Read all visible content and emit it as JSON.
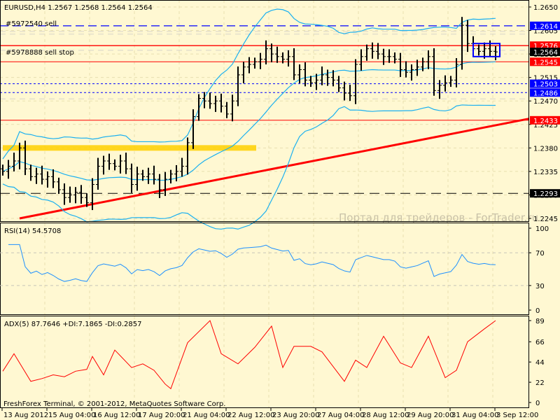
{
  "header": {
    "symbol_line": "EURUSD,H4  1.2567 1.2568 1.2564 1.2564"
  },
  "orders": [
    {
      "label": "#5972540 sell",
      "price": 1.2614,
      "color": "#0000ff",
      "style": "dash"
    },
    {
      "label": "#5978888 sell stop",
      "price": 1.2576,
      "color": "#ff0000",
      "style": "solid"
    }
  ],
  "price_labels": [
    {
      "text": "1.2614",
      "price": 1.2614,
      "bg": "#0000ff"
    },
    {
      "text": "1.2576",
      "price": 1.2576,
      "bg": "#ff0000"
    },
    {
      "text": "1.2564",
      "price": 1.2564,
      "bg": "#000000"
    },
    {
      "text": "1.2545",
      "price": 1.2545,
      "bg": "#ff0000"
    },
    {
      "text": "1.2503",
      "price": 1.2503,
      "bg": "#0000ff"
    },
    {
      "text": "1.2486",
      "price": 1.2486,
      "bg": "#0000ff"
    },
    {
      "text": "1.2433",
      "price": 1.2433,
      "bg": "#ff0000"
    },
    {
      "text": "1.2293",
      "price": 1.2293,
      "bg": "#000000"
    }
  ],
  "hlines": [
    {
      "price": 1.2545,
      "color": "#ff0000",
      "style": "solid"
    },
    {
      "price": 1.2503,
      "color": "#0000ff",
      "style": "dot"
    },
    {
      "price": 1.2486,
      "color": "#0000ff",
      "style": "dot"
    },
    {
      "price": 1.2433,
      "color": "#ff0000",
      "style": "solid"
    },
    {
      "price": 1.2293,
      "color": "#000000",
      "style": "longdash"
    }
  ],
  "watermark": "Портал для трейдеров - ForTrader.ru",
  "footer": "FreshForex Terminal, © 2001-2012, MetaQuotes Software Corp.",
  "chart_data": [
    {
      "type": "ohlc",
      "title": "EURUSD,H4",
      "ylim": [
        1.2245,
        1.265
      ],
      "y_ticks": [
        "1.2650",
        "1.2605",
        "1.2560",
        "1.2515",
        "1.2470",
        "1.2425",
        "1.2380",
        "1.2335",
        "1.2290",
        "1.2245"
      ],
      "x_ticks": [
        "13 Aug 2012",
        "15 Aug 04:00",
        "16 Aug 12:00",
        "17 Aug 20:00",
        "21 Aug 04:00",
        "22 Aug 12:00",
        "23 Aug 20:00",
        "27 Aug 04:00",
        "28 Aug 12:00",
        "29 Aug 20:00",
        "31 Aug 04:00",
        "3 Sep 12:00"
      ],
      "close": [
        1.2335,
        1.2345,
        1.2355,
        1.238,
        1.234,
        1.2325,
        1.233,
        1.232,
        1.2325,
        1.2315,
        1.23,
        1.2285,
        1.229,
        1.2295,
        1.2285,
        1.2275,
        1.231,
        1.2345,
        1.2355,
        1.235,
        1.2345,
        1.2355,
        1.234,
        1.231,
        1.233,
        1.2325,
        1.233,
        1.232,
        1.23,
        1.232,
        1.233,
        1.2335,
        1.2345,
        1.239,
        1.244,
        1.2475,
        1.247,
        1.2465,
        1.247,
        1.246,
        1.2445,
        1.247,
        1.252,
        1.2535,
        1.254,
        1.2545,
        1.255,
        1.257,
        1.256,
        1.2555,
        1.255,
        1.2555,
        1.252,
        1.253,
        1.251,
        1.2505,
        1.251,
        1.252,
        1.2515,
        1.251,
        1.2495,
        1.2485,
        1.248,
        1.254,
        1.2555,
        1.257,
        1.2565,
        1.256,
        1.2555,
        1.2555,
        1.255,
        1.253,
        1.2525,
        1.253,
        1.2535,
        1.2545,
        1.2555,
        1.249,
        1.25,
        1.2505,
        1.251,
        1.254,
        1.2615,
        1.258,
        1.257,
        1.2565,
        1.257,
        1.2565,
        1.2564
      ],
      "trendline": {
        "from": [
          3,
          1.2245
        ],
        "to": [
          94,
          1.2436
        ],
        "color": "#ff0000"
      },
      "zone": {
        "price": 1.238,
        "from_bar": 0,
        "to_bar": 45,
        "color": "#ffd000"
      },
      "band_color": "#1ab0f0"
    },
    {
      "type": "line",
      "title": "RSI(14) 54.5708",
      "ylim": [
        0,
        100
      ],
      "y_ticks": [
        "100",
        "70",
        "30",
        "0"
      ],
      "levels": [
        70,
        30
      ],
      "color": "#1e90ff"
    },
    {
      "type": "line",
      "title": "ADX(5) 87.7646 +DI:7.1865 -DI:0.2857",
      "ylim": [
        0,
        89
      ],
      "y_ticks": [
        "89",
        "66",
        "44",
        "22",
        "0"
      ],
      "color": "#ff0000",
      "adx": [
        [
          0,
          34
        ],
        [
          2,
          53
        ],
        [
          5,
          23
        ],
        [
          7,
          26
        ],
        [
          9,
          30
        ],
        [
          11,
          28
        ],
        [
          13,
          34
        ],
        [
          15,
          36
        ],
        [
          16,
          50
        ],
        [
          18,
          30
        ],
        [
          20,
          57
        ],
        [
          23,
          38
        ],
        [
          25,
          42
        ],
        [
          27,
          35
        ],
        [
          29,
          20
        ],
        [
          30,
          15
        ],
        [
          33,
          65
        ],
        [
          37,
          89
        ],
        [
          39,
          53
        ],
        [
          42,
          42
        ],
        [
          45,
          60
        ],
        [
          48,
          83
        ],
        [
          50,
          38
        ],
        [
          52,
          61
        ],
        [
          55,
          61
        ],
        [
          57,
          55
        ],
        [
          61,
          23
        ],
        [
          63,
          46
        ],
        [
          65,
          38
        ],
        [
          68,
          72
        ],
        [
          71,
          43
        ],
        [
          73,
          38
        ],
        [
          76,
          72
        ],
        [
          79,
          27
        ],
        [
          81,
          35
        ],
        [
          83,
          66
        ],
        [
          86,
          80
        ],
        [
          88,
          89
        ]
      ]
    }
  ]
}
